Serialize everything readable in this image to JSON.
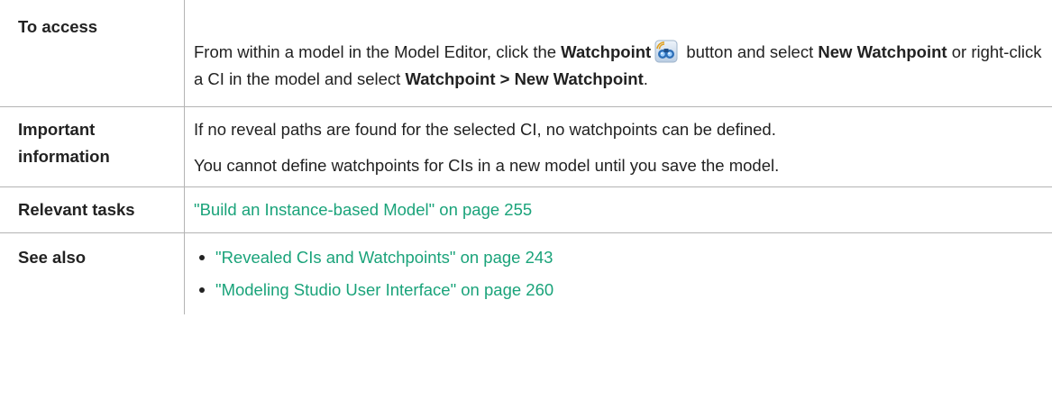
{
  "rows": {
    "access": {
      "label": "To access",
      "text_1": "From within a model in the Model Editor, click the ",
      "bold_1": "Watchpoint",
      "icon": "watchpoint-binoculars-icon",
      "text_2": " button and select ",
      "bold_2": "New Watchpoint",
      "text_3": " or right-click a CI in the model and select ",
      "bold_3": "Watchpoint > New Watchpoint",
      "text_4": "."
    },
    "important": {
      "label": "Important information",
      "paragraphs": [
        "If no reveal paths are found for the selected CI, no watchpoints can be defined.",
        "You cannot define watchpoints for CIs in a new model until you save the model."
      ]
    },
    "tasks": {
      "label": "Relevant tasks",
      "link": "\"Build an Instance-based Model\" on page 255"
    },
    "see_also": {
      "label": "See also",
      "links": [
        "\"Revealed CIs and Watchpoints\" on page 243",
        "\"Modeling Studio User Interface\" on page 260"
      ]
    }
  },
  "colors": {
    "link": "#1aa37a",
    "border": "#b4b4b4",
    "text": "#222222"
  }
}
